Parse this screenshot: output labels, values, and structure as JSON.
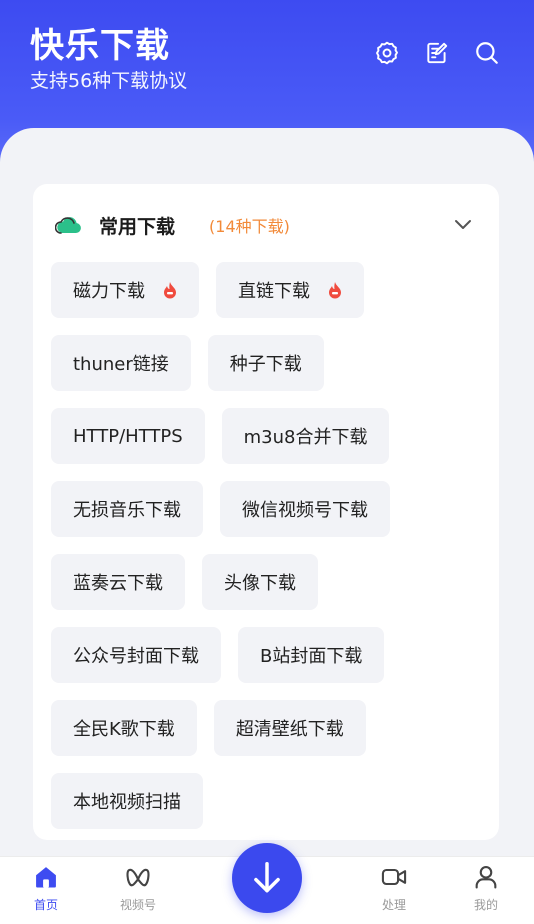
{
  "header": {
    "title": "快乐下载",
    "subtitle": "支持56种下载协议",
    "icons": [
      "settings-icon",
      "edit-note-icon",
      "search-icon"
    ]
  },
  "section": {
    "title": "常用下载",
    "count": "(14种下载)",
    "icon": "cloud-icon",
    "rows": [
      [
        {
          "label": "磁力下载",
          "hot": true
        },
        {
          "label": "直链下载",
          "hot": true
        }
      ],
      [
        {
          "label": "thuner链接"
        },
        {
          "label": "种子下载"
        }
      ],
      [
        {
          "label": "HTTP/HTTPS"
        },
        {
          "label": "m3u8合并下载"
        }
      ],
      [
        {
          "label": "无损音乐下载"
        },
        {
          "label": "微信视频号下载"
        }
      ],
      [
        {
          "label": "蓝奏云下载"
        },
        {
          "label": "头像下载"
        }
      ],
      [
        {
          "label": "公众号封面下载"
        },
        {
          "label": "B站封面下载"
        }
      ],
      [
        {
          "label": "全民K歌下载"
        },
        {
          "label": "超清壁纸下载"
        }
      ],
      [
        {
          "label": "本地视频扫描"
        }
      ]
    ]
  },
  "nav": {
    "items": [
      {
        "label": "首页",
        "icon": "home-icon",
        "active": true
      },
      {
        "label": "视频号",
        "icon": "channels-icon"
      },
      {
        "label": "处理",
        "icon": "video-camera-icon"
      },
      {
        "label": "我的",
        "icon": "profile-icon"
      }
    ],
    "fab_icon": "download-arrow-icon"
  },
  "colors": {
    "primary": "#3e4cf1",
    "accent": "#f28a39",
    "hot": "#f04b3e",
    "chip_bg": "#f2f3f7"
  }
}
